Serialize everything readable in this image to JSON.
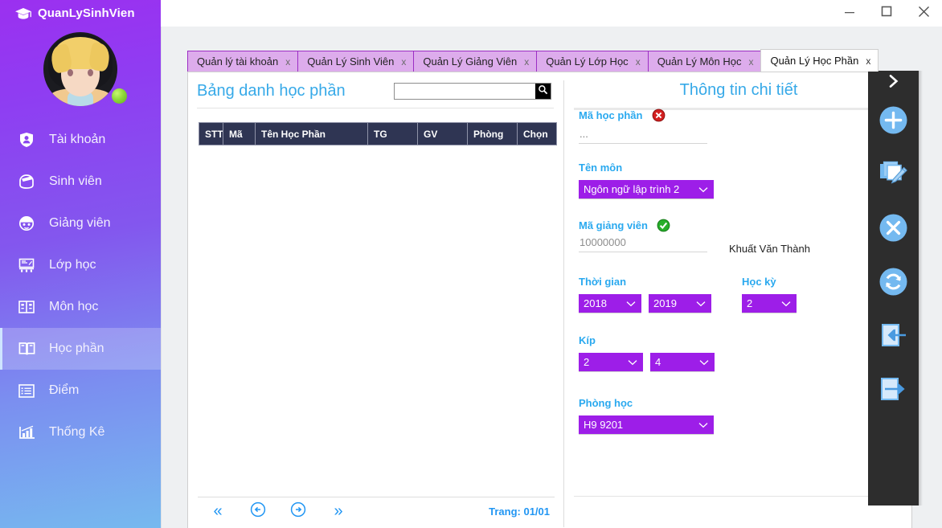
{
  "app": {
    "brand": "QuanLySinhVien",
    "brand_icon": "graduation-cap-icon",
    "watermark": ""
  },
  "window_controls": {
    "minimize": "minimize-icon",
    "maximize": "maximize-icon",
    "close": "close-icon"
  },
  "sidebar": {
    "avatar_alt": "user-avatar",
    "status": "online",
    "items": [
      {
        "label": "Tài khoản",
        "icon": "shield-user-icon",
        "active": false
      },
      {
        "label": "Sinh viên",
        "icon": "student-cap-icon",
        "active": false
      },
      {
        "label": "Giảng viên",
        "icon": "teacher-face-icon",
        "active": false
      },
      {
        "label": "Lớp học",
        "icon": "classroom-icon",
        "active": false
      },
      {
        "label": "Môn học",
        "icon": "subject-card-icon",
        "active": false
      },
      {
        "label": "Học phần",
        "icon": "open-book-icon",
        "active": true
      },
      {
        "label": "Điểm",
        "icon": "grade-list-icon",
        "active": false
      },
      {
        "label": "Thống Kê",
        "icon": "bar-chart-icon",
        "active": false
      }
    ]
  },
  "tabs": [
    {
      "label": "Quản lý tài khoản",
      "close": "x",
      "active": false
    },
    {
      "label": "Quản Lý Sinh Viên",
      "close": "x",
      "active": false
    },
    {
      "label": "Quản Lý Giảng Viên",
      "close": "x",
      "active": false
    },
    {
      "label": "Quản Lý Lớp Học",
      "close": "x",
      "active": false
    },
    {
      "label": "Quản Lý Môn Học",
      "close": "x",
      "active": false
    },
    {
      "label": "Quản Lý Học Phần",
      "close": "x",
      "active": true
    }
  ],
  "left_pane": {
    "title": "Bảng danh học phần",
    "search": {
      "value": "",
      "placeholder": "",
      "icon": "search-icon"
    },
    "table": {
      "columns": [
        "STT",
        "Mã",
        "Tên Học Phần",
        "TG",
        "GV",
        "Phòng",
        "Chọn"
      ],
      "rows": []
    },
    "pager": {
      "first": "«",
      "prev": "prev-circle-icon",
      "next": "next-circle-icon",
      "last": "»",
      "info": "Trang: 01/01"
    }
  },
  "detail": {
    "title": "Thông tin chi tiết",
    "fields": {
      "ma_hoc_phan": {
        "label": "Mã học phần",
        "value": "...",
        "status": "invalid"
      },
      "ten_mon": {
        "label": "Tên môn",
        "value": "Ngôn ngữ lập trình 2"
      },
      "ma_giang_vien": {
        "label": "Mã giảng viên",
        "value": "10000000",
        "status": "valid",
        "resolved_name": "Khuất Văn Thành"
      },
      "thoi_gian": {
        "label": "Thời gian",
        "from": "2018",
        "to": "2019"
      },
      "hoc_ky": {
        "label": "Học kỳ",
        "value": "2"
      },
      "kip": {
        "label": "Kíp",
        "from": "2",
        "to": "4"
      },
      "phong_hoc": {
        "label": "Phòng học",
        "value": "H9 9201"
      }
    }
  },
  "action_rail": {
    "toggle": "chevron-right-icon",
    "buttons": [
      {
        "name": "add",
        "icon": "plus-circle-icon"
      },
      {
        "name": "edit",
        "icon": "copy-pencil-icon"
      },
      {
        "name": "delete",
        "icon": "x-circle-icon"
      },
      {
        "name": "refresh",
        "icon": "refresh-circle-icon"
      },
      {
        "name": "import",
        "icon": "arrow-in-page-icon"
      },
      {
        "name": "export",
        "icon": "arrow-out-page-icon"
      }
    ]
  },
  "colors": {
    "accent_blue": "#36a9e8",
    "label_blue": "#2aa9ef",
    "combo_purple": "#9d1ee8",
    "tab_purple": "#ddacec",
    "tab_border": "#9c2ec4",
    "table_header": "#2f3553",
    "rail_dark": "#2d2d2d",
    "pager_blue": "#2196f3",
    "status_valid": "#27ae2a",
    "status_invalid": "#d32020"
  }
}
